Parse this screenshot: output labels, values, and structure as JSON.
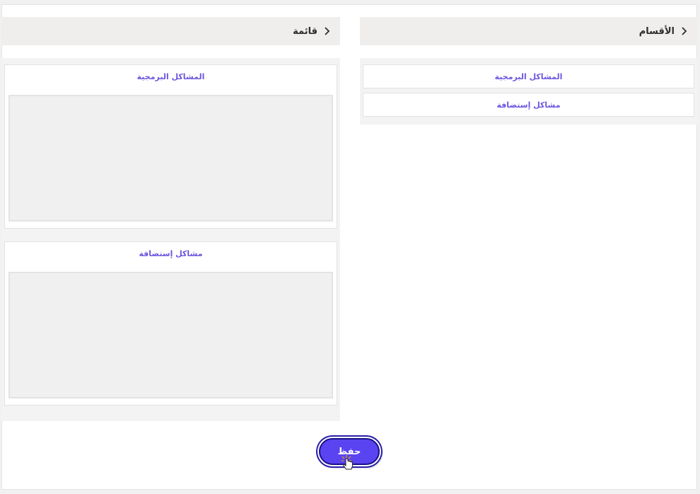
{
  "sections_panel": {
    "title": "الأقسام",
    "items": [
      {
        "label": "المشاكل البرمجية"
      },
      {
        "label": "مشاكل إستضافة"
      }
    ]
  },
  "list_panel": {
    "title": "قائمة",
    "lists": [
      {
        "title": "المشاكل البرمجية"
      },
      {
        "title": "مشاكل إستضافة"
      }
    ]
  },
  "actions": {
    "save_label": "حفظ"
  },
  "colors": {
    "accent": "#6a56e0",
    "button": "#5a43f0",
    "header_bg": "#efeeec"
  },
  "icons": {
    "header_chevron": "chevron-right-icon",
    "pointer": "hand-pointer-icon"
  }
}
